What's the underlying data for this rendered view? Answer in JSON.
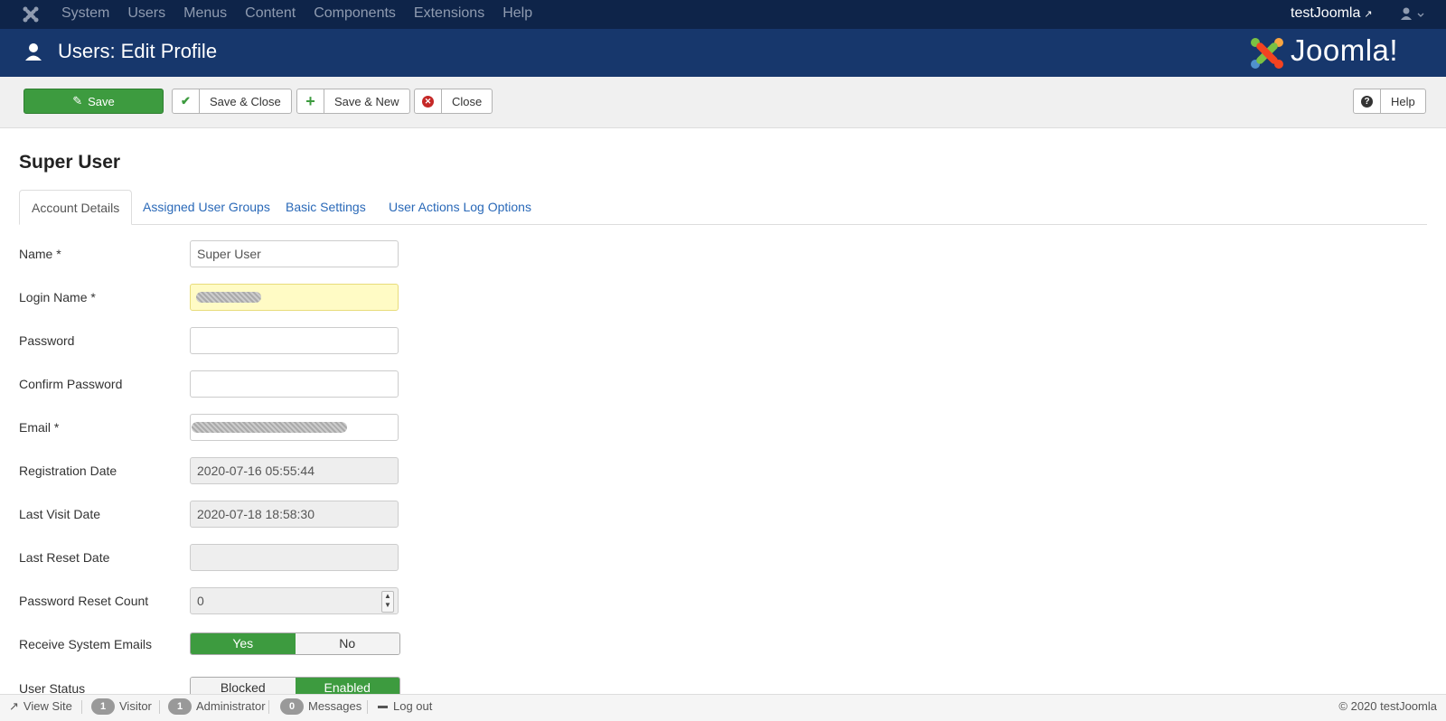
{
  "topnav": {
    "menu": [
      "System",
      "Users",
      "Menus",
      "Content",
      "Components",
      "Extensions",
      "Help"
    ],
    "site_name": "testJoomla"
  },
  "header": {
    "title": "Users: Edit Profile",
    "brand": "Joomla!"
  },
  "toolbar": {
    "save_label": "Save",
    "save_close_label": "Save & Close",
    "save_new_label": "Save & New",
    "close_label": "Close",
    "help_label": "Help"
  },
  "page": {
    "title": "Super User",
    "tabs": [
      "Account Details",
      "Assigned User Groups",
      "Basic Settings",
      "User Actions Log Options"
    ]
  },
  "form": {
    "name": {
      "label": "Name *",
      "value": "Super User"
    },
    "login": {
      "label": "Login Name *",
      "value": ""
    },
    "password": {
      "label": "Password",
      "value": ""
    },
    "confirm_password": {
      "label": "Confirm Password",
      "value": ""
    },
    "email": {
      "label": "Email *",
      "value": ""
    },
    "registration_date": {
      "label": "Registration Date",
      "value": "2020-07-16 05:55:44"
    },
    "last_visit_date": {
      "label": "Last Visit Date",
      "value": "2020-07-18 18:58:30"
    },
    "last_reset_date": {
      "label": "Last Reset Date",
      "value": ""
    },
    "reset_count": {
      "label": "Password Reset Count",
      "value": "0"
    },
    "system_emails": {
      "label": "Receive System Emails",
      "yes": "Yes",
      "no": "No",
      "selected": "Yes"
    },
    "user_status": {
      "label": "User Status",
      "blocked": "Blocked",
      "enabled": "Enabled",
      "selected": "Enabled"
    }
  },
  "statusbar": {
    "view_site": "View Site",
    "visitor_count": "1",
    "visitor_label": "Visitor",
    "admin_count": "1",
    "admin_label": "Administrator",
    "messages_count": "0",
    "messages_label": "Messages",
    "logout_label": "Log out",
    "copyright": "© 2020 testJoomla"
  },
  "colors": {
    "topnav_bg": "#0e2449",
    "header_bg": "#17376c",
    "accent_green": "#3d9b3f",
    "link_blue": "#2a69b8"
  }
}
